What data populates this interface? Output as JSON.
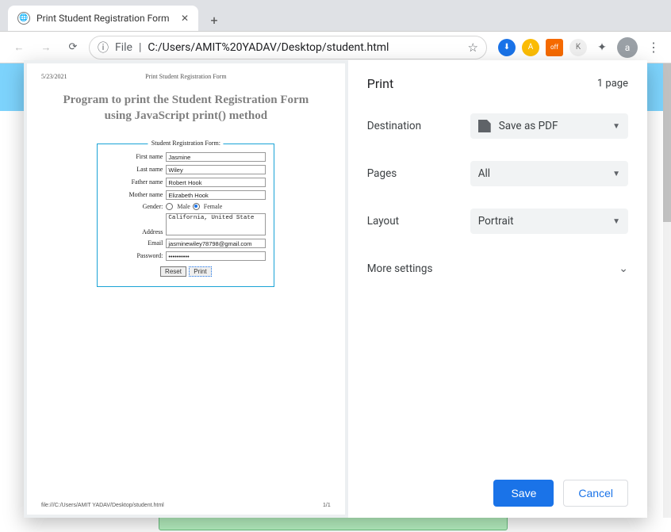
{
  "window": {
    "active_tab_title": "Print Student Registration Form",
    "url_prefix": "File",
    "url_sep": "|",
    "url": "C:/Users/AMIT%20YADAV/Desktop/student.html",
    "avatar_letter": "a",
    "profile_indicator": "▼"
  },
  "preview": {
    "date": "5/23/2021",
    "header": "Print Student Registration Form",
    "title_line1": "Program to print the Student Registration Form",
    "title_line2": "using JavaScript print() method",
    "legend": "Student Registration Form:",
    "fields": {
      "first_name_label": "First name",
      "first_name": "Jasmine",
      "last_name_label": "Last name",
      "last_name": "Wiley",
      "father_label": "Father name",
      "father": "Robert Hook",
      "mother_label": "Mother name",
      "mother": "Elizabeth Hook",
      "gender_label": "Gender:",
      "male": "Male",
      "female": "Female",
      "address_label": "Address",
      "address": "California, United State",
      "email_label": "Email",
      "email": "jasminewiley78798@gmail.com",
      "password_label": "Password:",
      "password": "••••••••••"
    },
    "buttons": {
      "reset": "Reset",
      "print": "Print"
    },
    "footer_left": "file:///C:/Users/AMIT YADAV/Desktop/student.html",
    "footer_right": "1/1"
  },
  "settings": {
    "title": "Print",
    "page_count": "1 page",
    "destination_label": "Destination",
    "destination_value": "Save as PDF",
    "pages_label": "Pages",
    "pages_value": "All",
    "layout_label": "Layout",
    "layout_value": "Portrait",
    "more_settings": "More settings",
    "save": "Save",
    "cancel": "Cancel"
  },
  "ext_icons": {
    "a": "⬇",
    "b": "A",
    "c": "off",
    "d": "K"
  }
}
